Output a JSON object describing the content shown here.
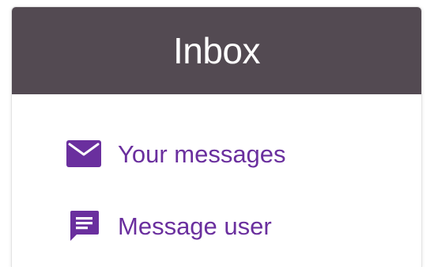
{
  "inbox": {
    "title": "Inbox",
    "header_color": "#534a52",
    "accent_color": "#6a2f9e",
    "items": [
      {
        "label": "Your messages",
        "icon": "envelope-icon"
      },
      {
        "label": "Message user",
        "icon": "chat-bubble-icon"
      }
    ]
  }
}
